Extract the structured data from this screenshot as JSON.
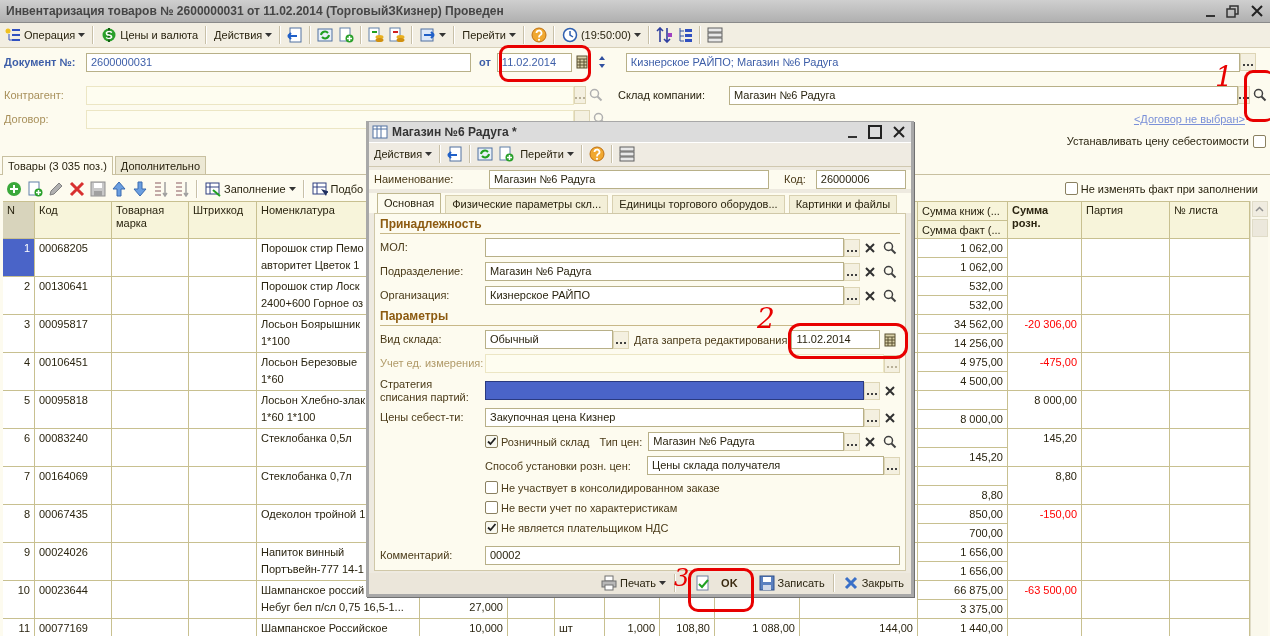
{
  "window": {
    "title": "Инвентаризация товаров № 2600000031 от 11.02.2014 (ТорговыйЗКизнер) Проведен"
  },
  "toolbar": {
    "operation": "Операция",
    "prices": "Цены и валюта",
    "actions": "Действия",
    "goto": "Перейти",
    "time": "(19:50:00)"
  },
  "header": {
    "doc_label": "Документ №:",
    "doc_number": "2600000031",
    "date_label": "от",
    "date": "11.02.2014",
    "org_field": "Кизнерское РАЙПО; Магазин №6 Радуга",
    "counterparty_label": "Контрагент:",
    "contract_label": "Договор:",
    "warehouse_label": "Склад компании:",
    "warehouse": "Магазин №6 Радуга",
    "contract_link": "<Договор не выбран>",
    "cost_price": {
      "label": "Устанавливать цену себестоимости",
      "checked": false
    }
  },
  "tabs": [
    {
      "label": "Товары (3 035 поз.)",
      "selected": true
    },
    {
      "label": "Дополнительно",
      "selected": false
    }
  ],
  "table_toolbar": {
    "fill": "Заполнение",
    "pick": "Подбо",
    "keep_fact": {
      "label": "Не изменять факт при заполнении",
      "checked": false
    }
  },
  "table": {
    "headers": {
      "n": "N",
      "code": "Код",
      "brand": "Товарная марка",
      "barcode": "Штрихкод",
      "name": "Номенклатура",
      "sum_book": "Сумма книж (...",
      "sum_fact": "Сумма факт (...",
      "sum_retail": "Сумма розн.",
      "party": "Партия",
      "sheet": "№ листа"
    },
    "rows": [
      {
        "selected": true,
        "n": "1",
        "code": "00068205",
        "name": [
          "Порошок стир Пемо",
          "авторитет Цветок 1"
        ],
        "sum_book": "1 062,00",
        "sum_fact": "1 062,00"
      },
      {
        "selected": false,
        "n": "2",
        "code": "00130641",
        "name": [
          "Порошок стир Лоск",
          "2400+600 Горное оз"
        ],
        "sum_book": "532,00",
        "sum_fact": "532,00"
      },
      {
        "selected": false,
        "n": "3",
        "code": "00095817",
        "name": [
          "Лосьон Боярышник",
          "1*100"
        ],
        "sum_book": "34 562,00",
        "sum_fact": "14 256,00",
        "sum_retail": "-20 306,00",
        "retail_negative": true
      },
      {
        "selected": false,
        "n": "4",
        "code": "00106451",
        "name": [
          "Лосьон Березовые",
          "1*60"
        ],
        "sum_book": "4 975,00",
        "sum_fact": "4 500,00",
        "sum_retail": "-475,00",
        "retail_negative": true
      },
      {
        "selected": false,
        "n": "5",
        "code": "00095818",
        "name": [
          "Лосьон Хлебно-злак",
          "1*60 1*100"
        ],
        "sum_fact": "8 000,00",
        "sum_retail": "8 000,00",
        "retail_negative": false
      },
      {
        "selected": false,
        "n": "6",
        "code": "00083240",
        "name": [
          "Стеклобанка 0,5л"
        ],
        "sum_fact": "145,20",
        "sum_retail": "145,20",
        "retail_negative": false
      },
      {
        "selected": false,
        "n": "7",
        "code": "00164069",
        "name": [
          "Стеклобанка 0,7л"
        ],
        "sum_fact": "8,80",
        "sum_retail": "8,80",
        "retail_negative": false
      },
      {
        "selected": false,
        "n": "8",
        "code": "00067435",
        "name": [
          "Одеколон тройной 1"
        ],
        "sum_book": "850,00",
        "sum_fact": "700,00",
        "sum_retail": "-150,00",
        "retail_negative": true
      },
      {
        "selected": false,
        "n": "9",
        "code": "00024026",
        "name": [
          "Напиток винный",
          "Портъвейн-777 14-1"
        ],
        "sum_book": "1 656,00",
        "sum_fact": "1 656,00"
      },
      {
        "selected": false,
        "n": "10",
        "code": "00023644",
        "name": [
          "Шампанское россий",
          "Небуг бел п/сл 0,75 16,5-1..."
        ],
        "column_6_fact": "27,000",
        "sum_book": "66 875,00",
        "sum_fact": "3 375,00",
        "sum_retail": "-63 500,00",
        "retail_negative": true
      },
      {
        "selected": false,
        "n": "11",
        "code": "00077169",
        "name": [
          "Шампанское Российское"
        ],
        "column_6": "10,000",
        "column_8": "шт",
        "column_9": "1,000",
        "column_10": "108,80",
        "column_11": "1 088,00",
        "column_12": "144,00",
        "sum_book": "1 440,00"
      }
    ]
  },
  "dialog": {
    "title": "Магазин №6 Радуга *",
    "toolbar": {
      "actions": "Действия",
      "goto": "Перейти"
    },
    "name_label": "Наименование:",
    "name": "Магазин №6 Радуга",
    "code_label": "Код:",
    "code": "26000006",
    "tabs": [
      {
        "label": "Основная",
        "selected": true
      },
      {
        "label": "Физические параметры скл...",
        "selected": false
      },
      {
        "label": "Единицы торгового оборудов...",
        "selected": false
      },
      {
        "label": "Картинки и файлы",
        "selected": false
      }
    ],
    "sections": [
      {
        "title": "Принадлежность",
        "rows": [
          {
            "kind": "lookup",
            "label": "МОЛ:"
          },
          {
            "kind": "lookup",
            "label": "Подразделение:",
            "value": "Магазин №6 Радуга"
          },
          {
            "kind": "lookup",
            "label": "Организация:",
            "value": "Кизнерское РАЙПО"
          }
        ]
      },
      {
        "title": "Параметры",
        "rows": [
          {
            "kind": "select_date",
            "label": "Вид склада:",
            "value": "Обычный",
            "date_label": "Дата запрета редактирования",
            "date": "11.02.2014"
          },
          {
            "kind": "select",
            "label": "Учет ед. измерения:",
            "disabled": true
          },
          {
            "kind": "clearable",
            "label": "Стратегия списания партий:",
            "highlighted": true
          },
          {
            "kind": "clearable",
            "label": "Цены себест-ти:",
            "value": "Закупочная цена Кизнер",
            "highlighted": false
          },
          {
            "kind": "check_lookup",
            "checkbox": "Розничный склад",
            "checked": true,
            "label": "Тип цен:",
            "value": "Магазин №6 Радуга"
          },
          {
            "kind": "indented_select",
            "label": "Способ установки розн. цен:",
            "value": "Цены склада получателя"
          },
          {
            "kind": "checkbox",
            "label": "Не участвует в консолидированном заказе",
            "checked": false
          },
          {
            "kind": "checkbox",
            "label": "Не вести учет по характеристикам",
            "checked": false
          },
          {
            "kind": "checkbox",
            "label": "Не является плательщиком НДС",
            "checked": true
          },
          {
            "kind": "text",
            "label": "Комментарий:",
            "value": "00002"
          }
        ]
      }
    ],
    "buttons": {
      "print": "Печать",
      "ok": "OK",
      "save": "Записать",
      "close": "Закрыть"
    }
  },
  "annotations": [
    {
      "label": "1"
    },
    {
      "label": "2"
    },
    {
      "label": "3"
    }
  ]
}
